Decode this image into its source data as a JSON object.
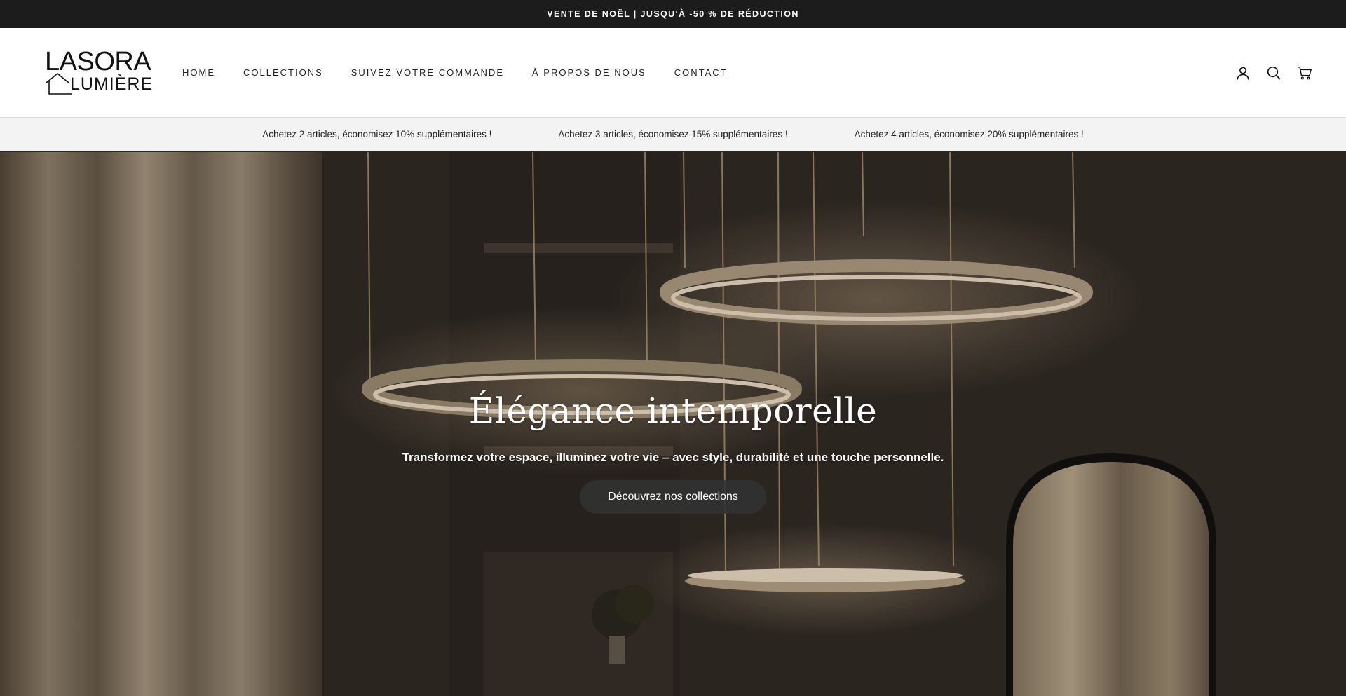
{
  "announcement": {
    "text": "VENTE DE NOËL | JUSQU'À -50 % DE RÉDUCTION"
  },
  "header": {
    "logo": {
      "line1": "LASORA",
      "line2": "LUMIÈRE"
    },
    "nav": [
      {
        "label": "HOME"
      },
      {
        "label": "COLLECTIONS"
      },
      {
        "label": "SUIVEZ VOTRE COMMANDE"
      },
      {
        "label": "À PROPOS DE NOUS"
      },
      {
        "label": "CONTACT"
      }
    ],
    "icons": [
      "account-icon",
      "search-icon",
      "cart-icon"
    ]
  },
  "promo": {
    "items": [
      "Achetez 2 articles, économisez 10% supplémentaires !",
      "Achetez 3 articles, économisez 15% supplémentaires !",
      "Achetez 4 articles, économisez 20% supplémentaires !"
    ]
  },
  "hero": {
    "title": "Élégance intemporelle",
    "subtitle": "Transformez votre espace, illuminez votre vie – avec style, durabilité et une touche personnelle.",
    "cta": "Découvrez nos collections"
  },
  "colors": {
    "announcement_bg": "#1c1c1c",
    "promo_bg": "#f3f3f3",
    "button_bg": "#323232"
  }
}
